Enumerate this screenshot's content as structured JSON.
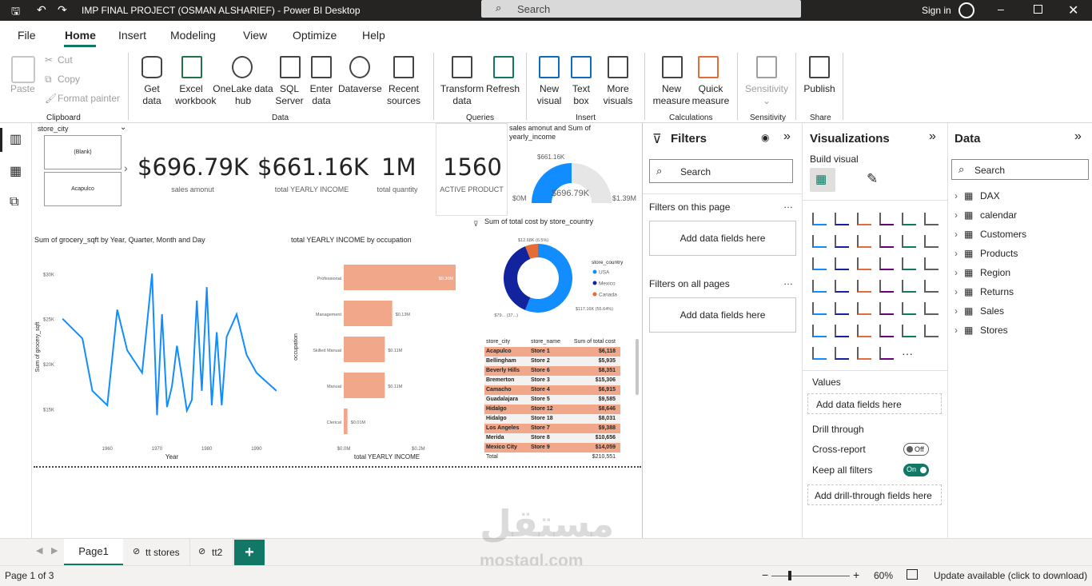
{
  "window": {
    "title": "IMP FINAL PROJECT (OSMAN ALSHARIEF) - Power BI Desktop",
    "search_placeholder": "Search",
    "sign_in": "Sign in"
  },
  "tabs": [
    "File",
    "Home",
    "Insert",
    "Modeling",
    "View",
    "Optimize",
    "Help"
  ],
  "ribbon": {
    "clipboard": {
      "paste": "Paste",
      "cut": "Cut",
      "copy": "Copy",
      "format_painter": "Format painter",
      "group": "Clipboard"
    },
    "data": {
      "get_data": "Get data",
      "excel": "Excel workbook",
      "onelake": "OneLake data hub",
      "sql": "SQL Server",
      "enter_data": "Enter data",
      "dataverse": "Dataverse",
      "recent": "Recent sources",
      "group": "Data"
    },
    "queries": {
      "transform": "Transform data",
      "refresh": "Refresh",
      "group": "Queries"
    },
    "insert": {
      "new_visual": "New visual",
      "text_box": "Text box",
      "more_visuals": "More visuals",
      "group": "Insert"
    },
    "calculations": {
      "new_measure": "New measure",
      "quick_measure": "Quick measure",
      "group": "Calculations"
    },
    "sensitivity": {
      "label": "Sensitivity",
      "group": "Sensitivity"
    },
    "share": {
      "publish": "Publish",
      "group": "Share"
    }
  },
  "report": {
    "slicer": {
      "title": "store_city",
      "items": [
        "(Blank)",
        "Acapulco"
      ]
    },
    "kpis": [
      {
        "value": "$696.79K",
        "label": "sales amonut"
      },
      {
        "value": "$661.16K",
        "label": "total YEARLY INCOME"
      },
      {
        "value": "1M",
        "label": "total quantity"
      },
      {
        "value": "1560",
        "label": "ACTIVE PRODUCT"
      }
    ],
    "gauge": {
      "title": "sales amonut and Sum of yearly_income",
      "value_label": "$696.79K",
      "target_label": "$661.16K",
      "min_label": "$0M",
      "max_label": "$1.39M",
      "fraction": 0.5
    },
    "line_title": "Sum of grocery_sqft by Year, Quarter, Month and Day",
    "bar_title": "total YEARLY INCOME by occupation",
    "donut_title": "Sum of total cost by store_country",
    "table": {
      "headers": [
        "store_city",
        "store_name",
        "Sum of total cost"
      ],
      "rows": [
        [
          "Acapulco",
          "Store 1",
          "$6,118"
        ],
        [
          "Bellingham",
          "Store 2",
          "$5,935"
        ],
        [
          "Beverly Hills",
          "Store 6",
          "$8,351"
        ],
        [
          "Bremerton",
          "Store 3",
          "$15,306"
        ],
        [
          "Camacho",
          "Store 4",
          "$6,915"
        ],
        [
          "Guadalajara",
          "Store 5",
          "$9,585"
        ],
        [
          "Hidalgo",
          "Store 12",
          "$8,646"
        ],
        [
          "Hidalgo",
          "Store 18",
          "$8,031"
        ],
        [
          "Los Angeles",
          "Store 7",
          "$9,388"
        ],
        [
          "Merida",
          "Store 8",
          "$10,656"
        ],
        [
          "Mexico City",
          "Store 9",
          "$14,059"
        ]
      ],
      "total": [
        "Total",
        "",
        "$210,551"
      ]
    }
  },
  "chart_data": [
    {
      "type": "line",
      "title": "Sum of grocery_sqft by Year, Quarter, Month and Day",
      "xlabel": "Year",
      "ylabel": "Sum of grocery_sqft",
      "x_ticks": [
        "1960",
        "1970",
        "1980",
        "1990"
      ],
      "y_ticks": [
        "$15K",
        "$20K",
        "$25K",
        "$30K"
      ],
      "ylim": [
        13000,
        31000
      ],
      "xlim": [
        1950,
        1995
      ],
      "x": [
        1951,
        1955,
        1957,
        1960,
        1962,
        1964,
        1967,
        1969,
        1970,
        1971,
        1972,
        1973,
        1974,
        1975,
        1976,
        1977,
        1978,
        1979,
        1980,
        1981,
        1982,
        1983,
        1984,
        1986,
        1988,
        1990,
        1992,
        1994
      ],
      "y": [
        25000,
        22800,
        17000,
        15400,
        26000,
        21500,
        19000,
        30000,
        14300,
        25500,
        15200,
        17500,
        22000,
        18500,
        14800,
        16000,
        27000,
        17000,
        28500,
        15400,
        23500,
        15400,
        23000,
        25500,
        21000,
        19000,
        18000,
        17000
      ],
      "series_color": "#118dff"
    },
    {
      "type": "bar",
      "title": "total YEARLY INCOME by occupation",
      "xlabel": "total YEARLY INCOME",
      "ylabel": "occupation",
      "categories": [
        "Professional",
        "Management",
        "Skilled Manual",
        "Manual",
        "Clerical"
      ],
      "values": [
        0.3,
        0.13,
        0.11,
        0.11,
        0.01
      ],
      "data_labels": [
        "$0.30M",
        "$0.13M",
        "$0.11M",
        "$0.11M",
        "$0.01M"
      ],
      "x_ticks": [
        "$0.0M",
        "$0.2M"
      ],
      "xlim": [
        0,
        0.3
      ],
      "color": "#f1a78a"
    },
    {
      "type": "pie",
      "title": "Sum of total cost by store_country",
      "legend_title": "store_country",
      "categories": [
        "USA",
        "Mexico",
        "Canada"
      ],
      "values": [
        117160,
        79000,
        12680
      ],
      "colors": [
        "#118dff",
        "#12239e",
        "#e66c37"
      ],
      "data_labels": [
        "$117.16K (55.64%)",
        "$79... (37...)",
        "$12.68K (6.5%)"
      ],
      "legend_position": "right"
    }
  ],
  "filters": {
    "title": "Filters",
    "search": "Search",
    "on_page": "Filters on this page",
    "on_all": "Filters on all pages",
    "add": "Add data fields here"
  },
  "visualizations": {
    "title": "Visualizations",
    "build": "Build visual",
    "values": "Values",
    "values_add": "Add data fields here",
    "drill": "Drill through",
    "cross": "Cross-report",
    "cross_state": "Off",
    "keep": "Keep all filters",
    "keep_state": "On",
    "drill_add": "Add drill-through fields here"
  },
  "data_pane": {
    "title": "Data",
    "search": "Search",
    "tables": [
      "DAX",
      "calendar",
      "Customers",
      "Products",
      "Region",
      "Returns",
      "Sales",
      "Stores"
    ]
  },
  "pages": [
    "Page1",
    "tt stores",
    "tt2"
  ],
  "status": {
    "page": "Page 1 of 3",
    "zoom": "60%",
    "update": "Update available (click to download)"
  },
  "watermark": {
    "arabic": "مستقل",
    "latin": "mostaql.com"
  }
}
